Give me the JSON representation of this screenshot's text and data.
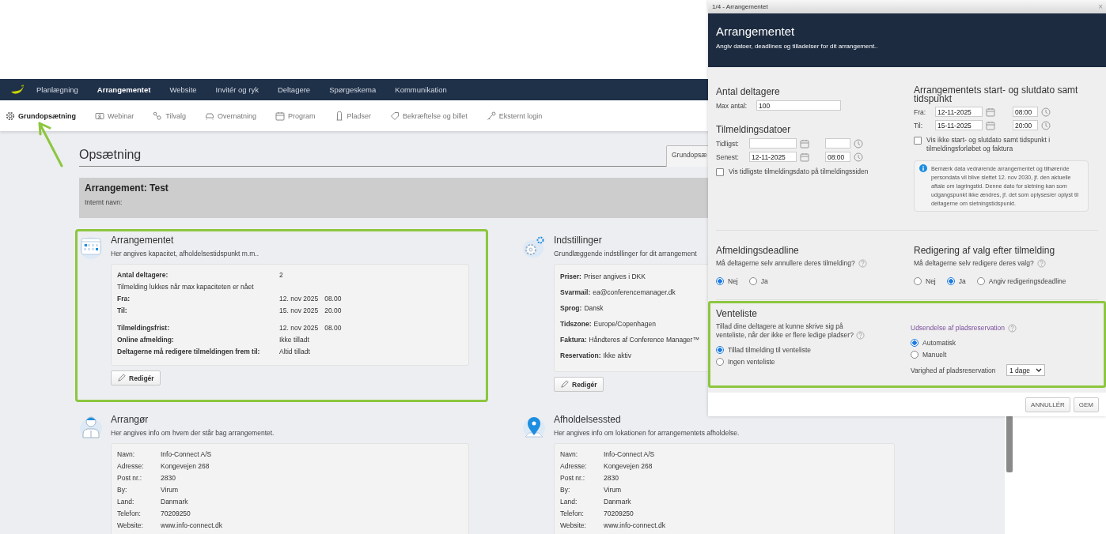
{
  "nav": {
    "items": [
      {
        "label": "Planlægning",
        "selected": false
      },
      {
        "label": "Arrangementet",
        "selected": true
      },
      {
        "label": "Website",
        "selected": false
      },
      {
        "label": "Invitér og ryk",
        "selected": false
      },
      {
        "label": "Deltagere",
        "selected": false
      },
      {
        "label": "Spørgeskema",
        "selected": false
      },
      {
        "label": "Kommunikation",
        "selected": false
      }
    ]
  },
  "subnav": {
    "items": [
      {
        "label": "Grundopsætning",
        "selected": true
      },
      {
        "label": "Webinar",
        "selected": false
      },
      {
        "label": "Tilvalg",
        "selected": false
      },
      {
        "label": "Overnatning",
        "selected": false
      },
      {
        "label": "Program",
        "selected": false
      },
      {
        "label": "Pladser",
        "selected": false
      },
      {
        "label": "Bekræftelse og billet",
        "selected": false
      },
      {
        "label": "Eksternt login",
        "selected": false
      }
    ]
  },
  "page": {
    "title": "Opsætning",
    "tab": "Grundopsæ"
  },
  "event": {
    "title": "Arrangement: Test",
    "internal_name_label": "Internt navn:"
  },
  "cards": [
    {
      "kind": "table",
      "title": "Arrangementet",
      "subtitle": "Her angives kapacitet, afholdelsestidspunkt m.m..",
      "highlighted": true,
      "button": "Redigér",
      "groups": [
        [
          {
            "label": "Antal deltagere:",
            "value": "2"
          },
          {
            "kind": "note",
            "label": "Tilmelding lukkes når max kapaciteten er nået"
          },
          {
            "label": "Fra:",
            "value": "12. nov 2025",
            "time": "08.00"
          },
          {
            "label": "Til:",
            "value": "15. nov 2025",
            "time": "20.00"
          }
        ],
        [
          {
            "label": "Tilmeldingsfrist:",
            "value": "12. nov 2025",
            "time": "08.00"
          },
          {
            "label": "Online afmelding:",
            "value": "Ikke tilladt"
          },
          {
            "label": "Deltagerne må redigere tilmeldingen frem til:",
            "value": "Altid tilladt"
          }
        ]
      ]
    },
    {
      "kind": "inline",
      "title": "Indstillinger",
      "subtitle": "Grundlæggende indstillinger for dit arrangement",
      "highlighted": false,
      "button": "Redigér",
      "groups": [
        [
          {
            "label": "Priser:",
            "value": "Priser angives i DKK"
          },
          {
            "label": "Svarmail:",
            "value": "ea@conferencemanager.dk"
          },
          {
            "label": "Sprog:",
            "value": "Dansk"
          },
          {
            "label": "Tidszone:",
            "value": "Europe/Copenhagen"
          },
          {
            "label": "Faktura:",
            "value": "Håndteres af Conference Manager™"
          },
          {
            "label": "Reservation:",
            "value": "Ikke aktiv"
          }
        ]
      ]
    },
    {
      "kind": "plain",
      "title": "Arrangør",
      "subtitle": "Her angives info om hvem der står bag arrangementet.",
      "highlighted": false,
      "groups": [
        [
          {
            "label": "Navn:",
            "value": "Info-Connect A/S"
          },
          {
            "label": "Adresse:",
            "value": "Kongevejen 268"
          },
          {
            "label": "Post nr.:",
            "value": "2830"
          },
          {
            "label": "By:",
            "value": "Virum"
          },
          {
            "label": "Land:",
            "value": "Danmark"
          },
          {
            "label": "Telefon:",
            "value": "70209250"
          },
          {
            "label": "Website:",
            "value": "www.info-connect.dk"
          }
        ]
      ]
    },
    {
      "kind": "plain",
      "title": "Afholdelsessted",
      "subtitle": "Her angives info om lokationen for arrangementets afholdelse.",
      "highlighted": false,
      "groups": [
        [
          {
            "label": "Navn:",
            "value": "Info-Connect A/S"
          },
          {
            "label": "Adresse:",
            "value": "Kongevejen 268"
          },
          {
            "label": "Post nr.:",
            "value": "2830"
          },
          {
            "label": "By:",
            "value": "Virum"
          },
          {
            "label": "Land:",
            "value": "Danmark"
          },
          {
            "label": "Telefon:",
            "value": "70209250"
          },
          {
            "label": "Website:",
            "value": "www.info-connect.dk"
          }
        ]
      ]
    }
  ],
  "modal": {
    "title_bar": "1/4 - Arrangementet",
    "close": "×",
    "header": {
      "title": "Arrangementet",
      "subtitle": "Angiv datoer, deadlines og tilladelser for dit arrangement.."
    },
    "capacity": {
      "heading": "Antal deltagere",
      "label": "Max antal:",
      "value": "100"
    },
    "registration_dates": {
      "heading": "Tilmeldingsdatoer",
      "rows": [
        {
          "label": "Tidligst:"
        },
        {
          "label": "Senest:",
          "date": "12-11-2025",
          "time": "08:00"
        }
      ]
    },
    "show_earliest": {
      "label": "Vis tidligste tilmeldingsdato på tilmeldingssiden",
      "checked": false
    },
    "event_dates": {
      "heading": "Arrangementets start- og slutdato samt tidspunkt",
      "rows": [
        {
          "label": "Fra:",
          "date": "12-11-2025",
          "time": "08:00"
        },
        {
          "label": "Til:",
          "date": "15-11-2025",
          "time": "20:00"
        }
      ]
    },
    "hide_dates": {
      "label": "Vis ikke start- og slutdato samt tidspunkt i tilmeldingsforløbet og faktura",
      "checked": false
    },
    "info_note": "Bemærk data vedrørende arrangementet og tilhørende persondata vil blive slettet 12. nov 2030, jf. den aktuelle aftale om lagringstid. Denne dato for sletning kan som udgangspunkt ikke ændres, jf. det som oplyses/er oplyst til deltagerne om sletningstidspunkt.",
    "cancellation": {
      "heading": "Afmeldingsdeadline",
      "question": "Må deltagerne selv annullere deres tilmelding?",
      "options": [
        {
          "label": "Nej",
          "selected": true
        },
        {
          "label": "Ja",
          "selected": false
        }
      ]
    },
    "editing": {
      "heading": "Redigering af valg efter tilmelding",
      "question": "Må deltagerne selv redigere deres valg?",
      "options": [
        {
          "label": "Nej",
          "selected": false
        },
        {
          "label": "Ja",
          "selected": true
        },
        {
          "label": "Angiv redigeringsdeadline",
          "selected": false
        }
      ]
    },
    "waitlist": {
      "heading": "Venteliste",
      "highlighted": true,
      "question": "Tillad dine deltagere at kunne skrive sig på venteliste, når der ikke er flere ledige pladser?",
      "options": [
        {
          "label": "Tillad tilmelding til venteliste",
          "selected": true
        },
        {
          "label": "Ingen venteliste",
          "selected": false
        }
      ],
      "reservation": {
        "heading": "Udsendelse af pladsreservation",
        "options": [
          {
            "label": "Automatisk",
            "selected": true
          },
          {
            "label": "Manuelt",
            "selected": false
          }
        ],
        "duration_label": "Varighed af pladsreservation",
        "duration_value": "1 dage"
      }
    },
    "buttons": [
      "ANNULLÉR",
      "GEM"
    ]
  }
}
